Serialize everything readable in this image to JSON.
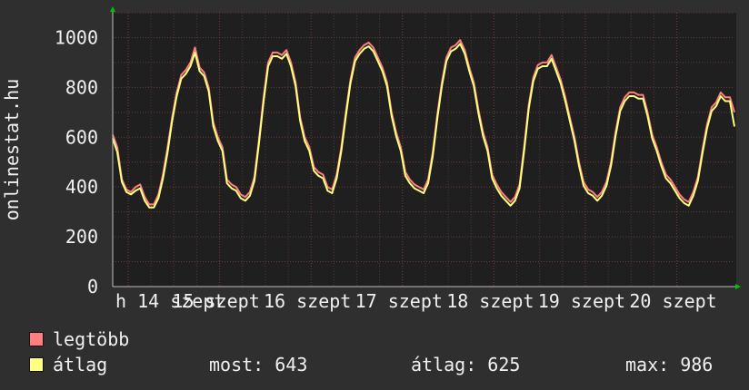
{
  "chart_data": {
    "type": "line",
    "ylabel": "onlinestat.hu",
    "ylim": [
      0,
      1100
    ],
    "y_ticks": [
      0,
      200,
      400,
      600,
      800,
      1000
    ],
    "x_tick_labels": [
      "h 14 szept",
      "15 szept",
      "16 szept",
      "17 szept",
      "18 szept",
      "19 szept",
      "20 szept"
    ],
    "grid": true,
    "series": [
      {
        "name": "legtöbb",
        "color": "#ff7f7f",
        "values": [
          610,
          560,
          430,
          390,
          380,
          400,
          410,
          360,
          330,
          330,
          370,
          450,
          560,
          680,
          780,
          850,
          870,
          900,
          960,
          880,
          860,
          800,
          660,
          600,
          560,
          430,
          410,
          400,
          370,
          360,
          380,
          440,
          590,
          760,
          900,
          940,
          940,
          930,
          950,
          900,
          820,
          680,
          600,
          560,
          480,
          460,
          450,
          400,
          390,
          450,
          560,
          700,
          830,
          920,
          950,
          970,
          980,
          960,
          920,
          880,
          820,
          700,
          620,
          560,
          460,
          430,
          410,
          400,
          390,
          430,
          540,
          690,
          820,
          920,
          960,
          970,
          990,
          950,
          880,
          820,
          710,
          620,
          560,
          450,
          410,
          380,
          360,
          340,
          360,
          410,
          560,
          730,
          840,
          890,
          900,
          900,
          930,
          880,
          830,
          760,
          680,
          600,
          500,
          420,
          390,
          380,
          360,
          380,
          420,
          500,
          620,
          720,
          760,
          780,
          780,
          770,
          770,
          700,
          610,
          560,
          500,
          450,
          430,
          400,
          370,
          350,
          340,
          380,
          440,
          550,
          650,
          720,
          740,
          780,
          760,
          760,
          700
        ]
      },
      {
        "name": "átlag",
        "color": "#ffff80",
        "values": [
          595,
          540,
          420,
          380,
          370,
          385,
          395,
          345,
          318,
          318,
          355,
          435,
          540,
          665,
          765,
          835,
          855,
          885,
          940,
          865,
          845,
          785,
          645,
          585,
          545,
          415,
          395,
          385,
          355,
          345,
          365,
          425,
          575,
          745,
          885,
          925,
          925,
          915,
          935,
          885,
          805,
          665,
          585,
          545,
          465,
          445,
          435,
          385,
          375,
          435,
          545,
          685,
          815,
          905,
          935,
          955,
          965,
          945,
          905,
          865,
          805,
          685,
          605,
          545,
          445,
          415,
          395,
          385,
          375,
          415,
          525,
          675,
          805,
          905,
          945,
          955,
          975,
          935,
          865,
          805,
          695,
          605,
          545,
          435,
          395,
          365,
          345,
          325,
          345,
          395,
          545,
          715,
          825,
          875,
          885,
          885,
          915,
          865,
          815,
          745,
          665,
          585,
          485,
          405,
          375,
          365,
          345,
          365,
          405,
          485,
          605,
          705,
          745,
          765,
          765,
          755,
          755,
          685,
          595,
          545,
          485,
          435,
          415,
          385,
          355,
          335,
          325,
          365,
          425,
          535,
          635,
          705,
          725,
          765,
          745,
          745,
          643
        ]
      }
    ]
  },
  "legend": {
    "max_label": "legtöbb",
    "avg_label": "átlag"
  },
  "stats": {
    "now": "most: 643",
    "avg": "átlag: 625",
    "max": "max: 986"
  }
}
